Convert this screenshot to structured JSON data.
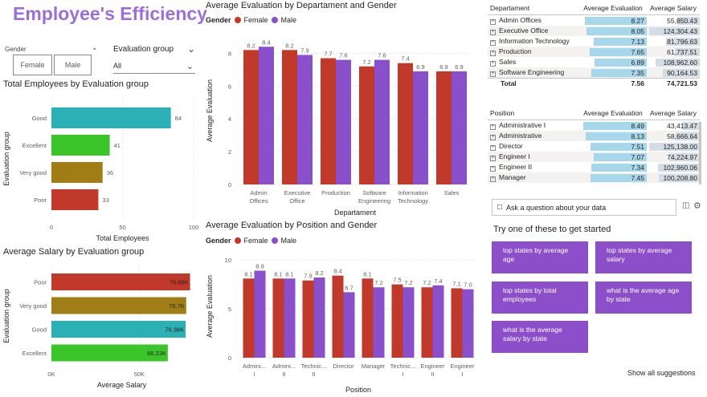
{
  "title": "Employee's Efficiency",
  "gender_slicer": {
    "label": "Gender",
    "options": [
      "Female",
      "Male"
    ]
  },
  "eval_slicer": {
    "label": "Evaluation group",
    "value": "All"
  },
  "colors": {
    "female": "#c0392b",
    "male": "#8a4fca",
    "good": "#2bb0b5",
    "excellent": "#3cc42b",
    "very_good": "#a07d15",
    "poor": "#c0392b"
  },
  "emp_chart": {
    "title": "Total Employees by Evaluation group",
    "ylabel": "Evaluation group",
    "xlabel": "Total Employees",
    "ticks": [
      "0",
      "50",
      "100"
    ],
    "chart_data": {
      "type": "bar",
      "orientation": "horizontal",
      "categories": [
        "Good",
        "Excellent",
        "Very good",
        "Poor"
      ],
      "values": [
        84,
        41,
        36,
        33
      ],
      "xlim": [
        0,
        100
      ]
    }
  },
  "sal_chart": {
    "title": "Average Salary by Evaluation group",
    "ylabel": "Evaluation group",
    "xlabel": "Average Salary",
    "ticks": [
      "0K",
      "50K"
    ],
    "chart_data": {
      "type": "bar",
      "orientation": "horizontal",
      "categories": [
        "Poor",
        "Very good",
        "Good",
        "Excellent"
      ],
      "values": [
        78890,
        76700,
        76380,
        66230
      ],
      "labels": [
        "78.89K",
        "76.7K",
        "76.38K",
        "66.23K"
      ],
      "xlim": [
        0,
        80000
      ]
    }
  },
  "dept_chart": {
    "title": "Average Evaluation by Departament and Gender",
    "legend_title": "Gender",
    "ylabel": "Average Evaluation",
    "xlabel": "Departament",
    "ticks": [
      "0",
      "2",
      "4",
      "6",
      "8"
    ],
    "chart_data": {
      "type": "bar",
      "categories": [
        [
          "Admin",
          "Offices"
        ],
        [
          "Executive",
          "Office"
        ],
        [
          "Production"
        ],
        [
          "Software",
          "Engineering"
        ],
        [
          "Information",
          "Technology"
        ],
        [
          "Sales"
        ]
      ],
      "series": [
        {
          "name": "Female",
          "values": [
            8.2,
            8.2,
            7.7,
            7.2,
            7.4,
            6.9
          ]
        },
        {
          "name": "Male",
          "values": [
            8.4,
            7.9,
            7.6,
            7.6,
            6.9,
            6.9
          ]
        }
      ],
      "ylim": [
        0,
        9
      ]
    }
  },
  "pos_chart": {
    "title": "Average Evaluation by Position and Gender",
    "legend_title": "Gender",
    "ylabel": "Average Evaluation",
    "xlabel": "Position",
    "ticks": [
      "0",
      "5",
      "10"
    ],
    "chart_data": {
      "type": "bar",
      "categories": [
        [
          "Admini...",
          "I"
        ],
        [
          "Admini...",
          "II"
        ],
        [
          "Technic...",
          "II"
        ],
        [
          "Director"
        ],
        [
          "Manager"
        ],
        [
          "Technic...",
          "I"
        ],
        [
          "Engineer",
          "II"
        ],
        [
          "Engineer",
          "I"
        ]
      ],
      "series": [
        {
          "name": "Female",
          "values": [
            8.1,
            8.1,
            7.9,
            8.4,
            8.1,
            7.5,
            7.2,
            7.1
          ]
        },
        {
          "name": "Male",
          "values": [
            8.9,
            8.1,
            8.2,
            6.7,
            7.2,
            7.2,
            7.4,
            7.0
          ]
        }
      ],
      "ylim": [
        0,
        10.5
      ]
    }
  },
  "dept_table": {
    "headers": [
      "Departament",
      "Average Evaluation",
      "Average Salary"
    ],
    "rows": [
      {
        "name": "Admin Offices",
        "eval": "8.27",
        "salary": "55,850.43",
        "ev": 8.27,
        "sal": 55850
      },
      {
        "name": "Executive Office",
        "eval": "8.05",
        "salary": "124,304.43",
        "ev": 8.05,
        "sal": 124304
      },
      {
        "name": "Information Technology",
        "eval": "7.13",
        "salary": "81,796.63",
        "ev": 7.13,
        "sal": 81796
      },
      {
        "name": "Production",
        "eval": "7.65",
        "salary": "61,737.51",
        "ev": 7.65,
        "sal": 61737
      },
      {
        "name": "Sales",
        "eval": "6.89",
        "salary": "108,962.60",
        "ev": 6.89,
        "sal": 108962
      },
      {
        "name": "Software Engineering",
        "eval": "7.35",
        "salary": "90,164.53",
        "ev": 7.35,
        "sal": 90164
      }
    ],
    "total": {
      "name": "Total",
      "eval": "7.56",
      "salary": "74,721.53"
    }
  },
  "pos_table": {
    "headers": [
      "Position",
      "Average Evaluation",
      "Average Salary"
    ],
    "rows": [
      {
        "name": "Administrative I",
        "eval": "8.49",
        "salary": "43,413.47",
        "ev": 8.49,
        "sal": 43413
      },
      {
        "name": "Administrative",
        "eval": "8.13",
        "salary": "58,666.64",
        "ev": 8.13,
        "sal": 58666
      },
      {
        "name": "Director",
        "eval": "7.51",
        "salary": "125,138.00",
        "ev": 7.51,
        "sal": 125138
      },
      {
        "name": "Engineer I",
        "eval": "7.07",
        "salary": "74,224.97",
        "ev": 7.07,
        "sal": 74224
      },
      {
        "name": "Engineer II",
        "eval": "7.34",
        "salary": "102,960.06",
        "ev": 7.34,
        "sal": 102960
      },
      {
        "name": "Manager",
        "eval": "7.45",
        "salary": "100,208.80",
        "ev": 7.45,
        "sal": 100208
      }
    ]
  },
  "qa": {
    "placeholder": "Ask a question about your data",
    "try_label": "Try one of these to get started",
    "suggestions": [
      "top states by average age",
      "top states by average salary",
      "top states by total employees",
      "what is the average age by state",
      "what is the average salary by state"
    ],
    "show_all": "Show all suggestions"
  }
}
